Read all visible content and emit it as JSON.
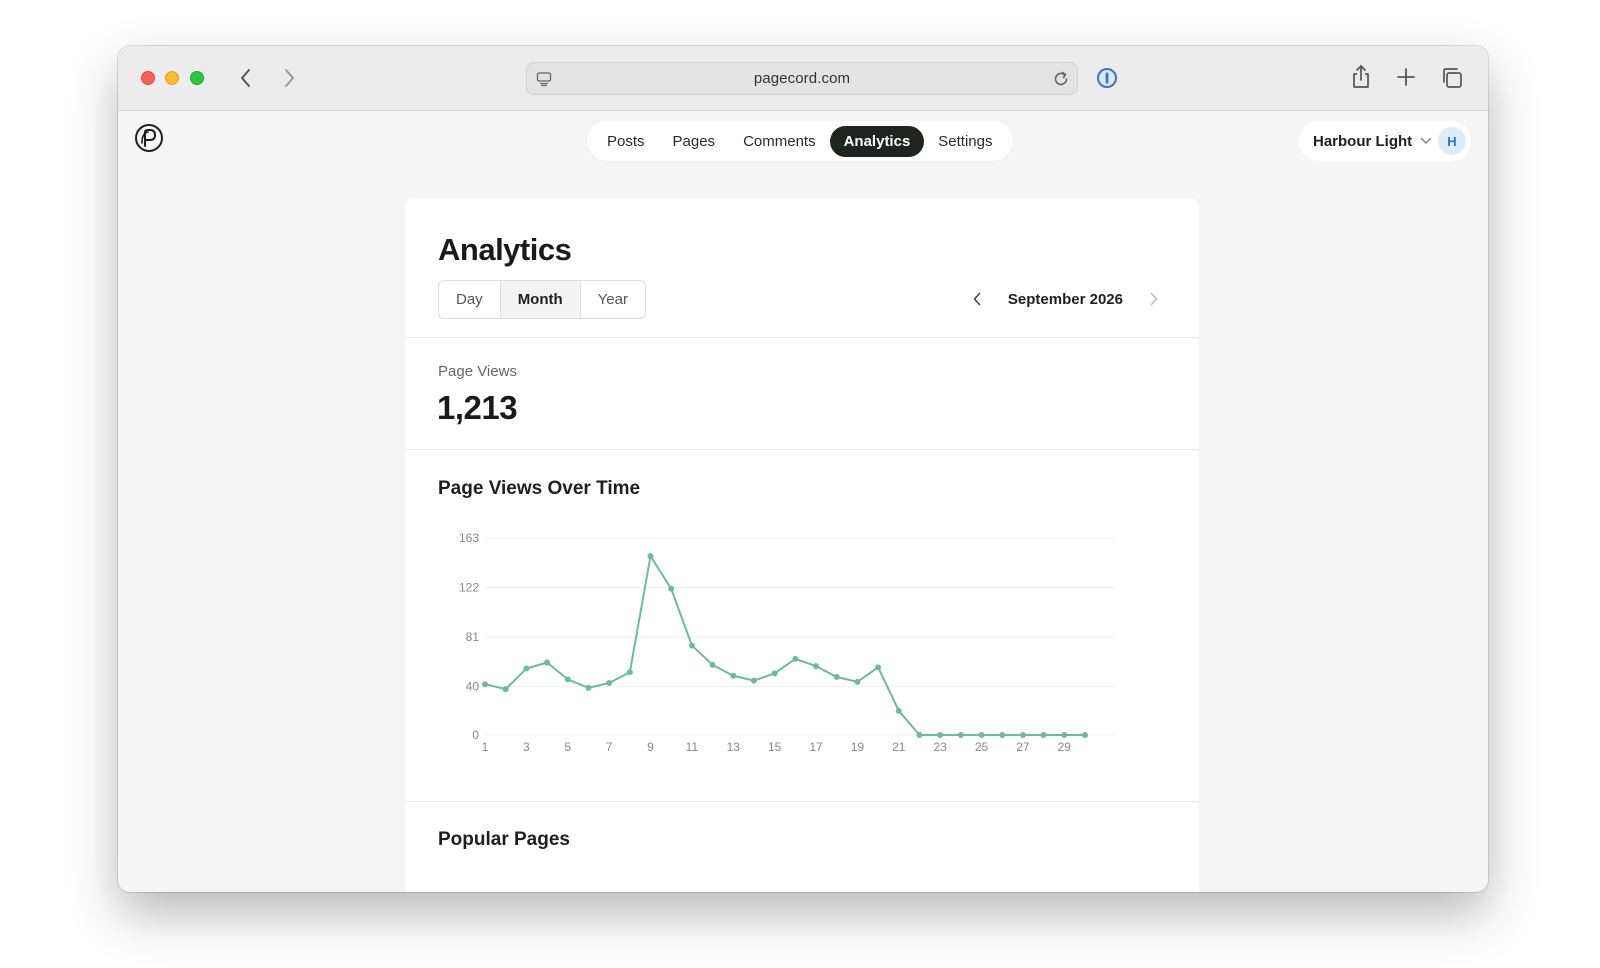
{
  "browser": {
    "url": "pagecord.com",
    "icons": {
      "back": "chevron-left-icon",
      "forward": "chevron-right-icon",
      "site": "site-settings-icon",
      "reload": "reload-icon",
      "extension": "password-manager-icon",
      "share": "share-icon",
      "new_tab": "plus-icon",
      "tab_overview": "tabs-icon"
    }
  },
  "app": {
    "logo": "pagecord-logo-icon",
    "nav": [
      {
        "label": "Posts",
        "active": false
      },
      {
        "label": "Pages",
        "active": false
      },
      {
        "label": "Comments",
        "active": false
      },
      {
        "label": "Analytics",
        "active": true
      },
      {
        "label": "Settings",
        "active": false
      }
    ],
    "account": {
      "name": "Harbour Light",
      "avatar_initial": "H"
    }
  },
  "analytics": {
    "title": "Analytics",
    "periods": [
      {
        "label": "Day",
        "active": false
      },
      {
        "label": "Month",
        "active": true
      },
      {
        "label": "Year",
        "active": false
      }
    ],
    "current_period": "September 2026",
    "page_views_label": "Page Views",
    "page_views_value": "1,213",
    "chart_title": "Page Views Over Time",
    "popular_title": "Popular Pages"
  },
  "chart_data": {
    "type": "line",
    "title": "Page Views Over Time",
    "xlabel": "",
    "ylabel": "",
    "x": [
      1,
      2,
      3,
      4,
      5,
      6,
      7,
      8,
      9,
      10,
      11,
      12,
      13,
      14,
      15,
      16,
      17,
      18,
      19,
      20,
      21,
      22,
      23,
      24,
      25,
      26,
      27,
      28,
      29,
      30
    ],
    "x_tick_labels": [
      "1",
      "3",
      "5",
      "7",
      "9",
      "11",
      "13",
      "15",
      "17",
      "19",
      "21",
      "23",
      "25",
      "27",
      "29"
    ],
    "y_ticks": [
      0,
      40,
      81,
      122,
      163
    ],
    "ylim": [
      0,
      163
    ],
    "grid": true,
    "color": "#6dbb9b",
    "series": [
      {
        "values": [
          42,
          38,
          55,
          60,
          46,
          39,
          43,
          52,
          148,
          121,
          74,
          58,
          49,
          45,
          51,
          63,
          57,
          48,
          44,
          56,
          20,
          0,
          0,
          0,
          0,
          0,
          0,
          0,
          0,
          0
        ]
      }
    ]
  }
}
